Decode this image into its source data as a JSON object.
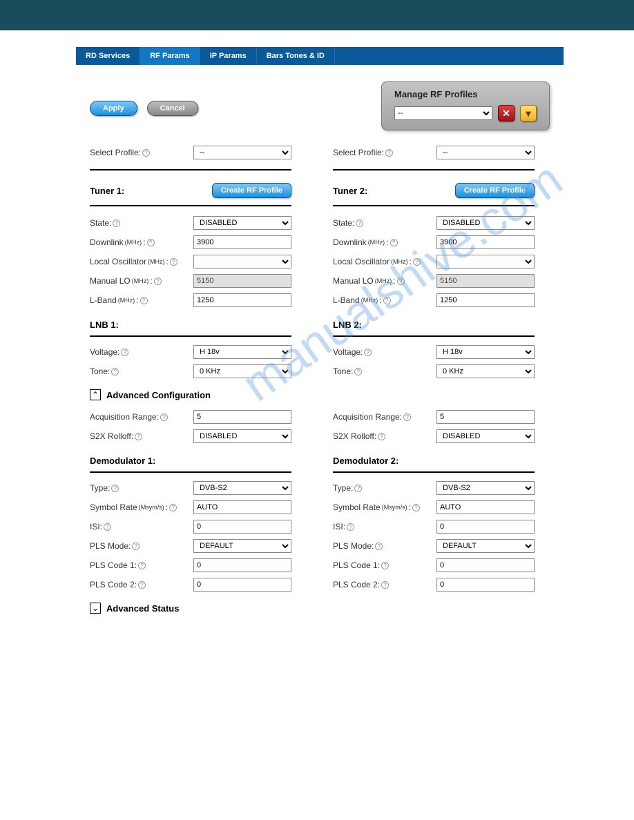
{
  "tabs": {
    "t0": "RD Services",
    "t1": "RF Params",
    "t2": "IP Params",
    "t3": "Bars Tones & ID"
  },
  "toolbar": {
    "apply": "Apply",
    "cancel": "Cancel"
  },
  "manager": {
    "title": "Manage RF Profiles",
    "selected": "--"
  },
  "labels": {
    "select_profile": "Select Profile:",
    "tuner1": "Tuner 1:",
    "tuner2": "Tuner 2:",
    "create": "Create RF Profile",
    "state": "State:",
    "downlink": "Downlink",
    "local_osc": "Local Oscillator",
    "manual_lo": "Manual LO",
    "lband": "L-Band",
    "lnb1": "LNB 1:",
    "lnb2": "LNB 2:",
    "voltage": "Voltage:",
    "tone": "Tone:",
    "adv_cfg": "Advanced Configuration",
    "acq_range": "Acquisition Range:",
    "s2x": "S2X Rolloff:",
    "demod1": "Demodulator 1:",
    "demod2": "Demodulator 2:",
    "type": "Type:",
    "symrate": "Symbol Rate",
    "isi": "ISI:",
    "plsmode": "PLS Mode:",
    "pls1": "PLS Code 1:",
    "pls2": "PLS Code 2:",
    "adv_status": "Advanced Status",
    "mhz": "(MHz)",
    "msym": "(Msym/s)"
  },
  "tuner1": {
    "profile": "--",
    "state": "DISABLED",
    "downlink": "3900",
    "local_osc": "",
    "manual_lo": "5150",
    "lband": "1250"
  },
  "tuner2": {
    "profile": "--",
    "state": "DISABLED",
    "downlink": "3900",
    "local_osc": "",
    "manual_lo": "5150",
    "lband": "1250"
  },
  "lnb1": {
    "voltage": "H 18v",
    "tone": "0 KHz"
  },
  "lnb2": {
    "voltage": "H 18v",
    "tone": "0 KHz"
  },
  "adv": {
    "acq1": "5",
    "s2x1": "DISABLED",
    "acq2": "5",
    "s2x2": "DISABLED"
  },
  "demod1": {
    "type": "DVB-S2",
    "symrate": "AUTO",
    "isi": "0",
    "plsmode": "DEFAULT",
    "pls1": "0",
    "pls2": "0"
  },
  "demod2": {
    "type": "DVB-S2",
    "symrate": "AUTO",
    "isi": "0",
    "plsmode": "DEFAULT",
    "pls1": "0",
    "pls2": "0"
  },
  "watermark": "manualshive.com"
}
